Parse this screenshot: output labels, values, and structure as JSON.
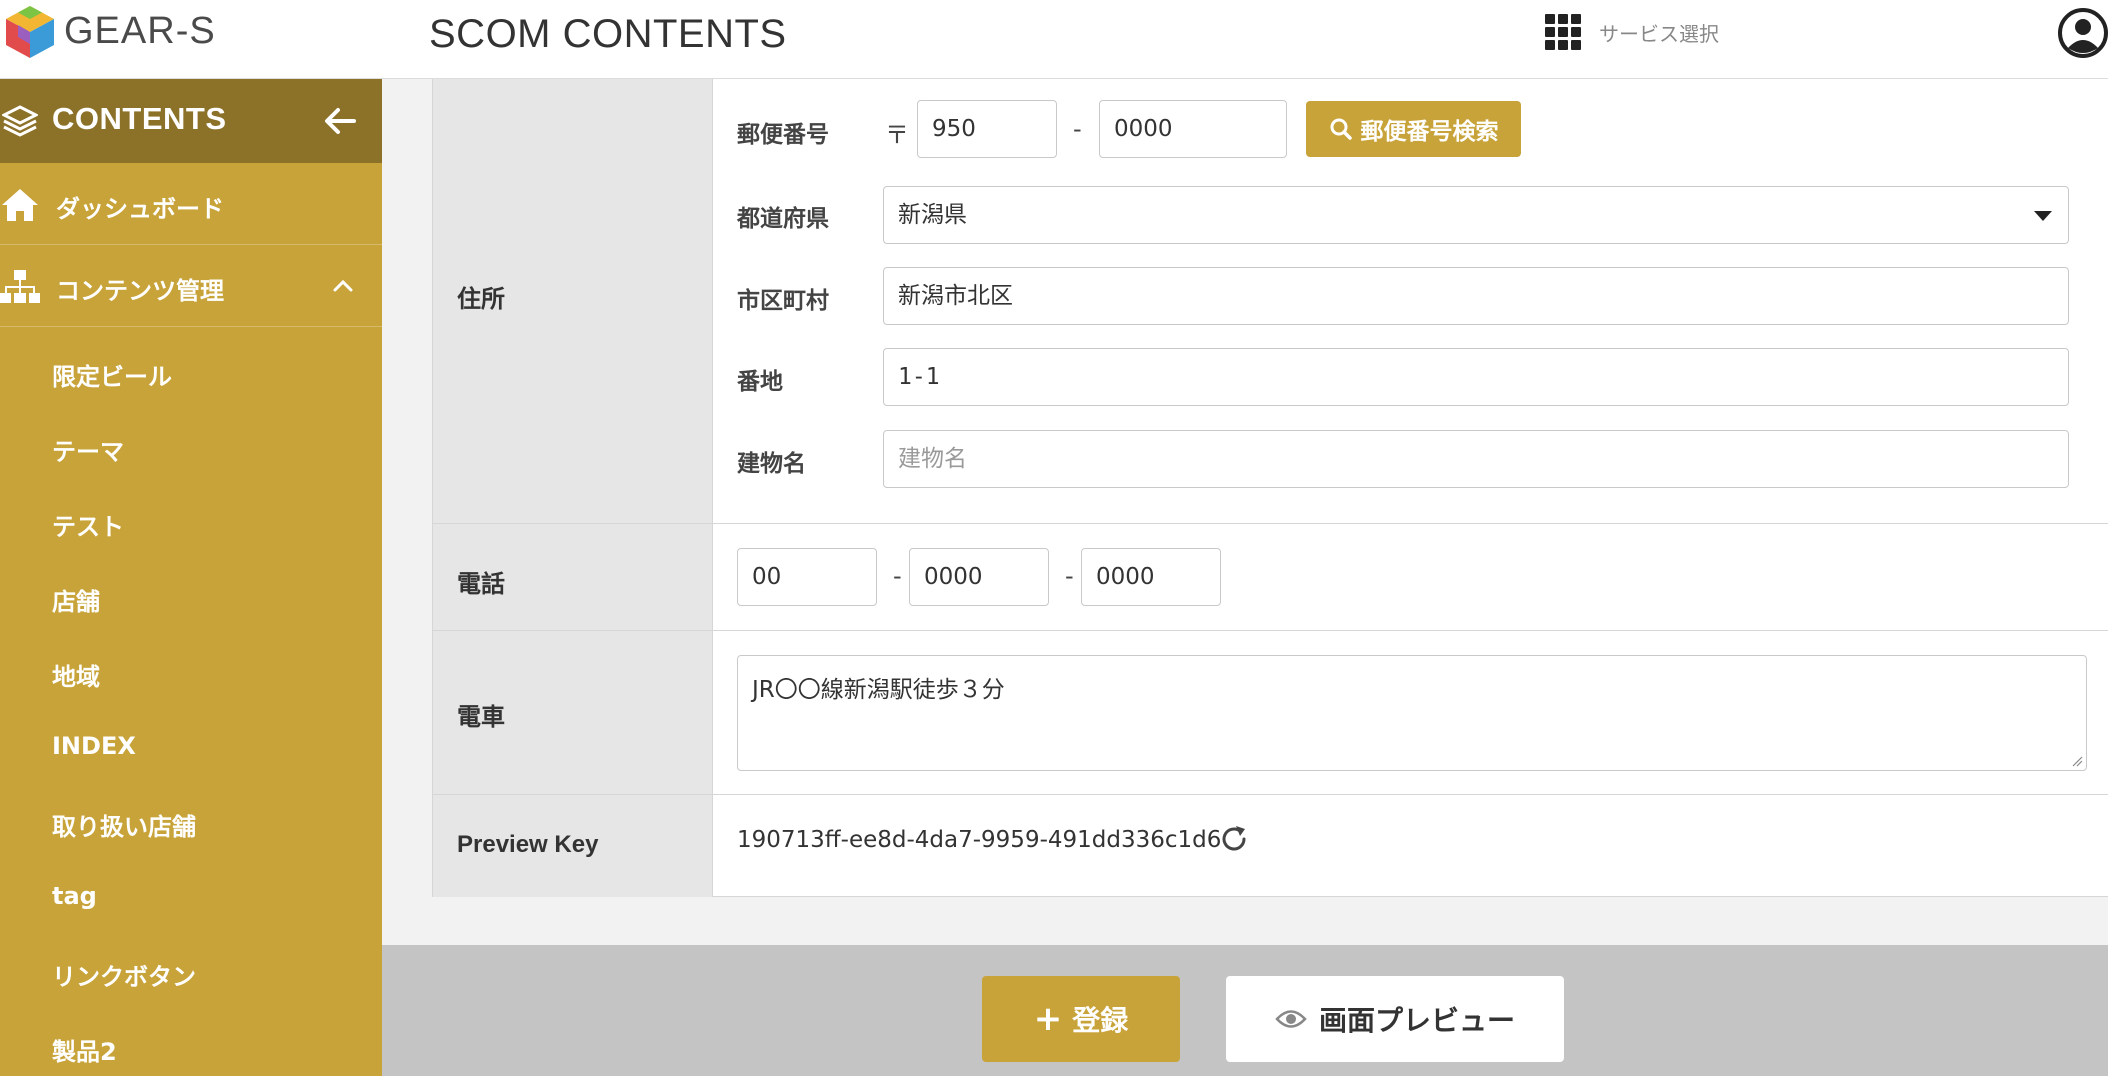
{
  "header": {
    "brand": "GEAR-S",
    "title": "SCOM CONTENTS",
    "service_select_label": "サービス選択",
    "icons": [
      "logo-cube-icon",
      "grid-icon",
      "user-icon"
    ]
  },
  "sidebar": {
    "head_title": "CONTENTS",
    "dashboard_label": "ダッシュボード",
    "content_mgmt_label": "コンテンツ管理",
    "sub_items": [
      "限定ビール",
      "テーマ",
      "テスト",
      "店舗",
      "地域",
      "INDEX",
      "取り扱い店舗",
      "tag",
      "リンクボタン",
      "製品2"
    ],
    "colors": {
      "sidebar_bg": "#c8a33a",
      "sidebar_head_bg": "#8c7129"
    }
  },
  "form": {
    "address": {
      "label": "住所",
      "postal": {
        "label": "郵便番号",
        "mark": "〒",
        "part1": "950",
        "dash": "-",
        "part2": "0000",
        "search_button": "郵便番号検索"
      },
      "prefecture": {
        "label": "都道府県",
        "value": "新潟県"
      },
      "city": {
        "label": "市区町村",
        "value": "新潟市北区"
      },
      "street": {
        "label": "番地",
        "value": "1-1"
      },
      "building": {
        "label": "建物名",
        "placeholder": "建物名"
      }
    },
    "phone": {
      "label": "電話",
      "part1": "00",
      "part2": "0000",
      "part3": "0000",
      "dash": "-"
    },
    "train": {
      "label": "電車",
      "value": "JR〇〇線新潟駅徒歩３分"
    },
    "preview_key": {
      "label": "Preview Key",
      "value": "190713ff-ee8d-4da7-9959-491dd336c1d6"
    }
  },
  "actions": {
    "register_label": "登録",
    "preview_label": "画面プレビュー",
    "accent_color": "#c8a33a"
  }
}
